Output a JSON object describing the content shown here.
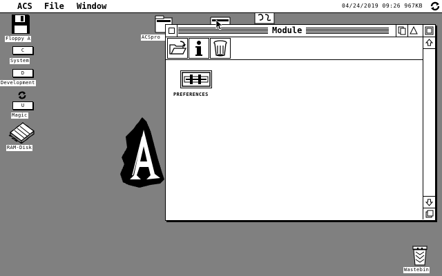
{
  "menubar": {
    "items": [
      {
        "label": "ACS"
      },
      {
        "label": "File"
      },
      {
        "label": "Window"
      }
    ],
    "clock": "04/24/2019 09:26 967KB"
  },
  "desktop": {
    "icons": [
      {
        "label": "Floppy A",
        "icon": "floppy-disk-icon"
      },
      {
        "label": "System",
        "drive": "C",
        "icon": "drive-icon"
      },
      {
        "label": "Development",
        "drive": "D",
        "icon": "drive-icon"
      },
      {
        "label": "Magic",
        "drive": "U",
        "icon": "drive-icon"
      },
      {
        "label": "RAM-Disk",
        "icon": "ram-disk-icon"
      },
      {
        "label": "ACSpro",
        "icon": "folder-icon"
      },
      {
        "label": "Wastebin",
        "icon": "trash-icon"
      }
    ]
  },
  "window": {
    "title": "Module",
    "toolbar": [
      {
        "icon": "open-folder-icon"
      },
      {
        "icon": "info-icon",
        "glyph": "i"
      },
      {
        "icon": "trash-icon"
      }
    ],
    "items": [
      {
        "label": "PREFERENCES",
        "icon": "preferences-icon"
      }
    ]
  }
}
